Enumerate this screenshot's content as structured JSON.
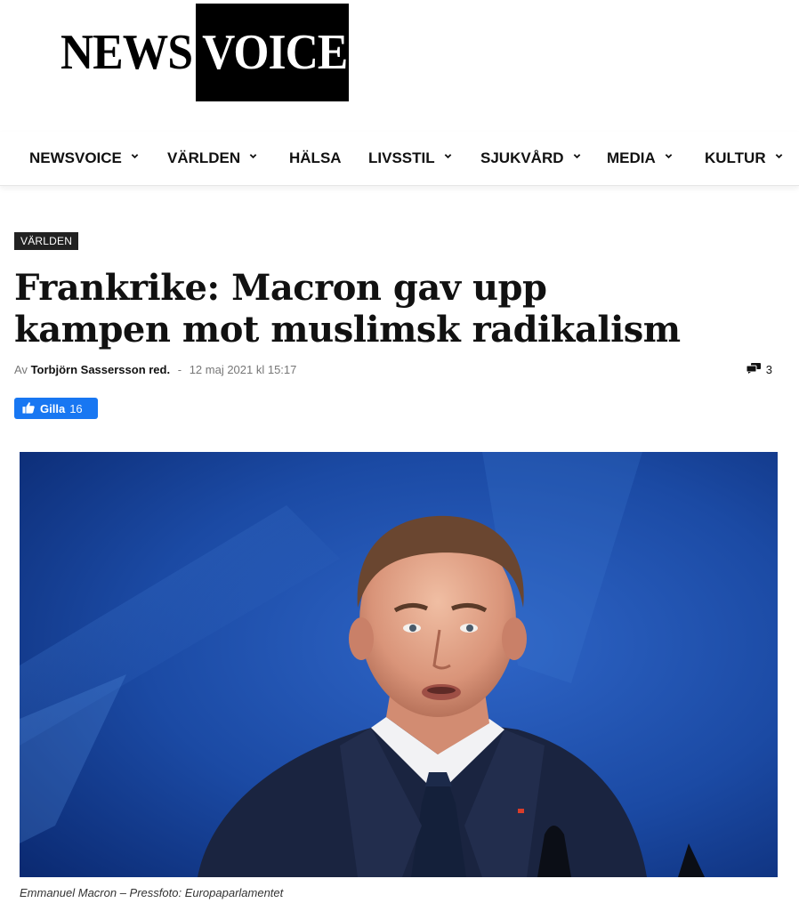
{
  "logo": {
    "part1": "NEWS",
    "part2": "VOICE"
  },
  "nav": {
    "items": [
      {
        "label": "NEWSVOICE",
        "dropdown": true
      },
      {
        "label": "VÄRLDEN",
        "dropdown": true
      },
      {
        "label": "HÄLSA",
        "dropdown": false
      },
      {
        "label": "LIVSSTIL",
        "dropdown": true
      },
      {
        "label": "SJUKVÅRD",
        "dropdown": true
      },
      {
        "label": "MEDIA",
        "dropdown": true
      },
      {
        "label": "KULTUR",
        "dropdown": true
      }
    ]
  },
  "article": {
    "category": "VÄRLDEN",
    "title_line1": "Frankrike: Macron gav upp",
    "title_line2": "kampen mot muslimsk radikalism",
    "byline_prefix": "Av",
    "author": "Torbjörn Sassersson red.",
    "separator": "-",
    "date": "12 maj 2021 kl 15:17",
    "comment_count": "3",
    "like_label": "Gilla",
    "like_count": "16",
    "image_alt": "Emmanuel Macron",
    "caption": "Emmanuel Macron – Pressfoto: Europaparlamentet"
  },
  "colors": {
    "facebook_blue": "#1877f2",
    "tag_bg": "#222222",
    "photo_bg": "#0d3a8f"
  },
  "icons": {
    "comments": "comment-bubbles-icon",
    "like": "thumbs-up-icon",
    "dropdown": "chevron-down-icon"
  }
}
